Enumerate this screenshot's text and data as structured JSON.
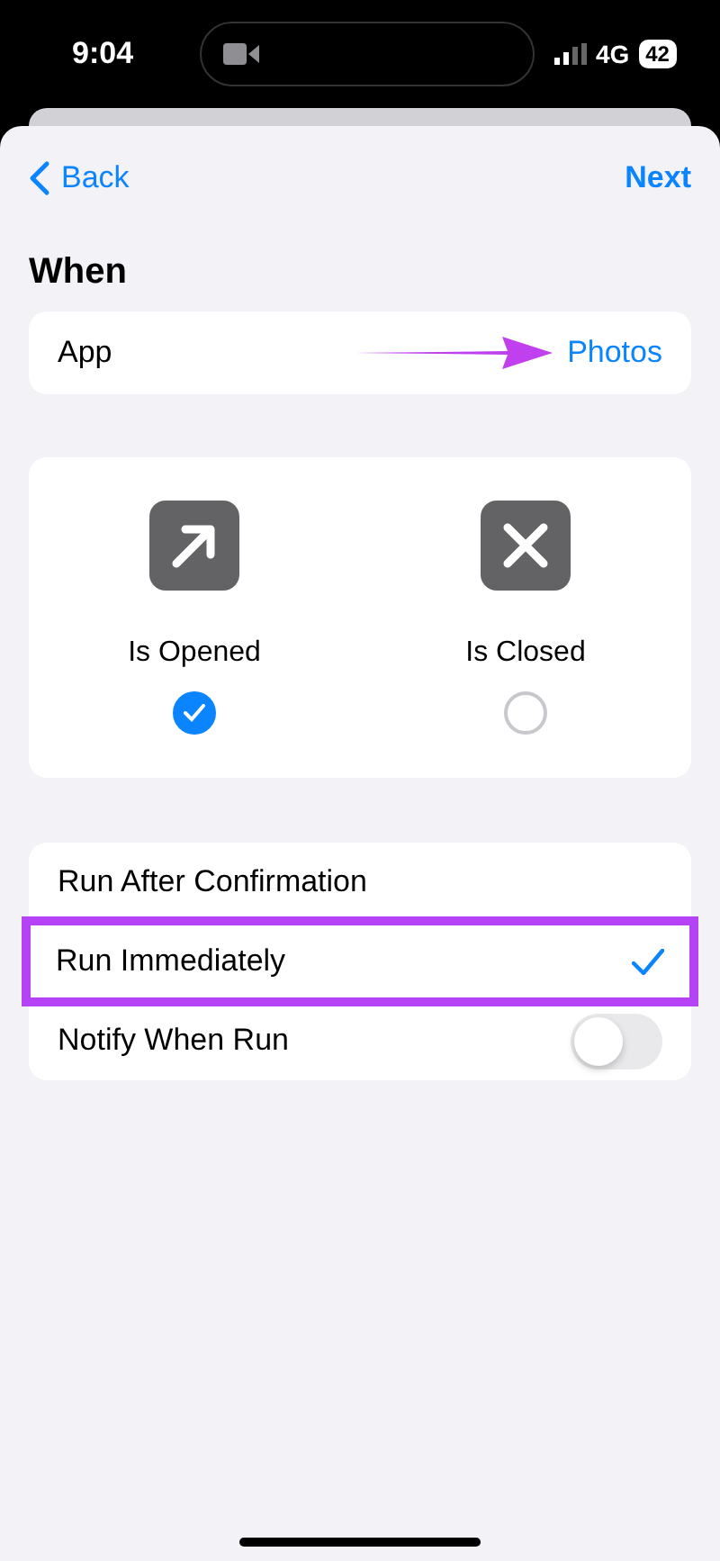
{
  "status_bar": {
    "time": "9:04",
    "network": "4G",
    "battery": "42"
  },
  "nav": {
    "back": "Back",
    "next": "Next"
  },
  "section_title": "When",
  "app_row": {
    "label": "App",
    "value": "Photos",
    "annotated": true
  },
  "triggers": [
    {
      "label": "Is Opened",
      "kind": "opened",
      "selected": true
    },
    {
      "label": "Is Closed",
      "kind": "closed",
      "selected": false
    }
  ],
  "options": [
    {
      "label": "Run After Confirmation",
      "kind": "choice",
      "selected": false,
      "highlighted": false
    },
    {
      "label": "Run Immediately",
      "kind": "choice",
      "selected": true,
      "highlighted": true
    },
    {
      "label": "Notify When Run",
      "kind": "toggle",
      "on": false,
      "highlighted": false
    }
  ]
}
